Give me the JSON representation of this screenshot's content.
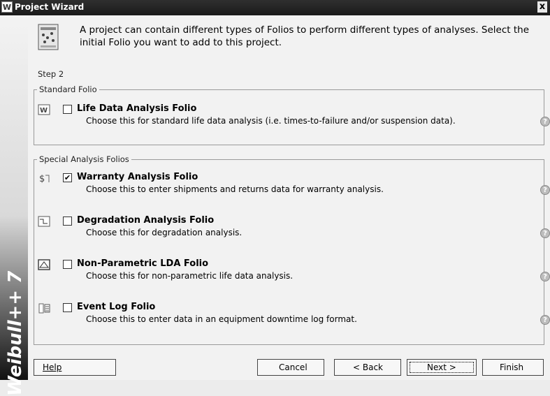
{
  "window": {
    "title": "Project Wizard",
    "app_icon": "W",
    "close": "x"
  },
  "sidebar": {
    "label": "Weibull++ 7"
  },
  "intro": {
    "text": "A project can contain different types of Folios to perform different types of analyses. Select the initial Folio you want to add to this project.",
    "step": "Step 2"
  },
  "standard": {
    "label": "Standard Folio",
    "items": [
      {
        "name": "Life Data Analysis Folio",
        "desc": "Choose this for standard life data analysis (i.e. times-to-failure and/or suspension data).",
        "checked": false,
        "icon": "life-data-folio-icon"
      }
    ]
  },
  "special": {
    "label": "Special Analysis Folios",
    "items": [
      {
        "name": "Warranty Analysis Folio",
        "desc": "Choose this to enter shipments and returns data for warranty analysis.",
        "checked": true,
        "icon": "warranty-folio-icon"
      },
      {
        "name": "Degradation Analysis Folio",
        "desc": "Choose this for degradation analysis.",
        "checked": false,
        "icon": "degradation-folio-icon"
      },
      {
        "name": "Non-Parametric LDA Folio",
        "desc": "Choose this for non-parametric life data analysis.",
        "checked": false,
        "icon": "non-parametric-folio-icon"
      },
      {
        "name": "Event Log Folio",
        "desc": "Choose this to enter data in an equipment downtime log format.",
        "checked": false,
        "icon": "event-log-folio-icon"
      }
    ]
  },
  "help_glyph": "?",
  "check_glyph": "✔",
  "buttons": {
    "help": "Help",
    "cancel": "Cancel",
    "back": "< Back",
    "next": "Next >",
    "finish": "Finish"
  }
}
